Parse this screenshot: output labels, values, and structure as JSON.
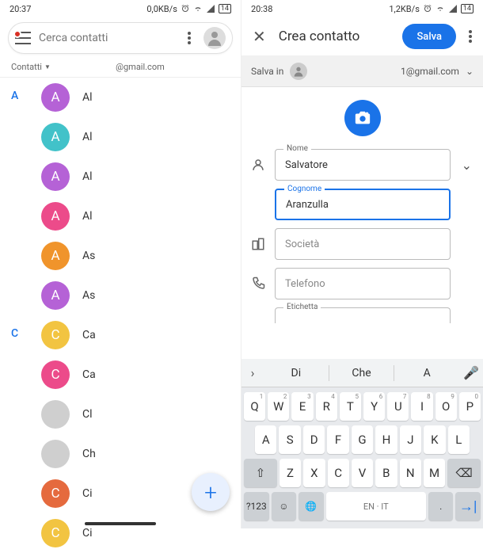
{
  "left": {
    "status": {
      "time": "20:37",
      "net": "0,0KB/s",
      "batt": "14"
    },
    "search_placeholder": "Cerca contatti",
    "tabs": {
      "all": "Contatti",
      "email": "@gmail.com"
    },
    "sections": [
      {
        "letter": "A",
        "items": [
          {
            "initial": "A",
            "color": "#b562d6",
            "name": "Al"
          },
          {
            "initial": "A",
            "color": "#42c2c9",
            "name": "Al"
          },
          {
            "initial": "A",
            "color": "#b562d6",
            "name": "Al"
          },
          {
            "initial": "A",
            "color": "#ec4b8a",
            "name": "Al"
          },
          {
            "initial": "A",
            "color": "#f0942b",
            "name": "As"
          },
          {
            "initial": "A",
            "color": "#b562d6",
            "name": "As"
          }
        ]
      },
      {
        "letter": "C",
        "items": [
          {
            "initial": "C",
            "color": "#f2c441",
            "name": "Ca"
          },
          {
            "initial": "C",
            "color": "#ec4b8a",
            "name": "Ca"
          },
          {
            "initial": "",
            "color": "#cfcfcf",
            "name": "Cl"
          },
          {
            "initial": "",
            "color": "#cfcfcf",
            "name": "Ch"
          },
          {
            "initial": "C",
            "color": "#e56a3e",
            "name": "Ci"
          },
          {
            "initial": "C",
            "color": "#f2c441",
            "name": "Ci"
          }
        ]
      }
    ]
  },
  "right": {
    "status": {
      "time": "20:38",
      "net": "1,2KB/s",
      "batt": "14"
    },
    "title": "Crea contatto",
    "save": "Salva",
    "save_in_label": "Salva in",
    "save_in_email": "1@gmail.com",
    "fields": {
      "nome_label": "Nome",
      "nome_value": "Salvatore",
      "cognome_label": "Cognome",
      "cognome_value": "Aranzulla",
      "societa": "Società",
      "telefono": "Telefono",
      "etichetta": "Etichetta"
    },
    "kb": {
      "suggestions": [
        "Di",
        "Che",
        "A"
      ],
      "row1": [
        "Q",
        "W",
        "E",
        "R",
        "T",
        "Y",
        "U",
        "I",
        "O",
        "P"
      ],
      "row2": [
        "A",
        "S",
        "D",
        "F",
        "G",
        "H",
        "J",
        "K",
        "L"
      ],
      "row3": [
        "Z",
        "X",
        "C",
        "V",
        "B",
        "N",
        "M"
      ],
      "sym": "?123",
      "lang": "EN · IT"
    }
  }
}
